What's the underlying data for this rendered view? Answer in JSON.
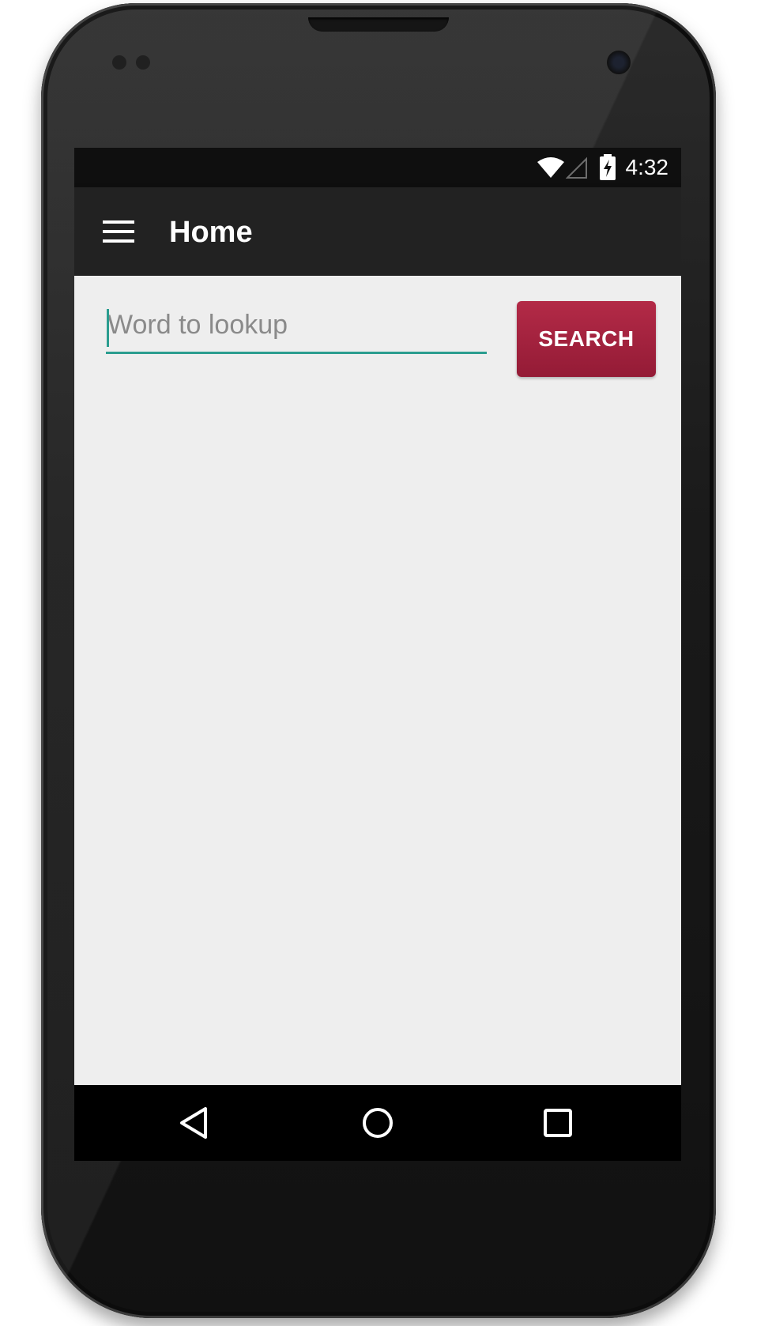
{
  "status_bar": {
    "time": "4:32",
    "icons": [
      "wifi-icon",
      "cell-signal-icon",
      "battery-charging-icon"
    ]
  },
  "app_bar": {
    "menu_icon": "hamburger-menu-icon",
    "title": "Home"
  },
  "search": {
    "input_value": "",
    "placeholder": "Word to lookup",
    "button_label": "SEARCH"
  },
  "nav_bar": {
    "icons": [
      "back-icon",
      "home-icon",
      "recents-icon"
    ]
  },
  "colors": {
    "accent": "#2a9d8f",
    "button": "#a52240",
    "app_bar": "#222222",
    "background": "#eeeeee"
  }
}
